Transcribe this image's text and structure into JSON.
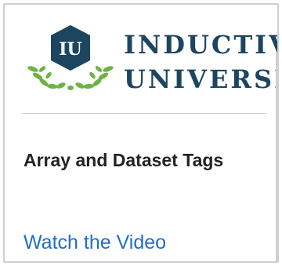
{
  "logo": {
    "badge_text": "IU",
    "line1": "INDUCTIVE",
    "line2": "UNIVERSITY",
    "colors": {
      "badge": "#1c4560",
      "laurel": "#6fb245",
      "wordmark": "#1c4560"
    }
  },
  "article": {
    "title": "Array and Dataset Tags",
    "link_label": "Watch the Video",
    "link_color": "#1f6ec9"
  }
}
